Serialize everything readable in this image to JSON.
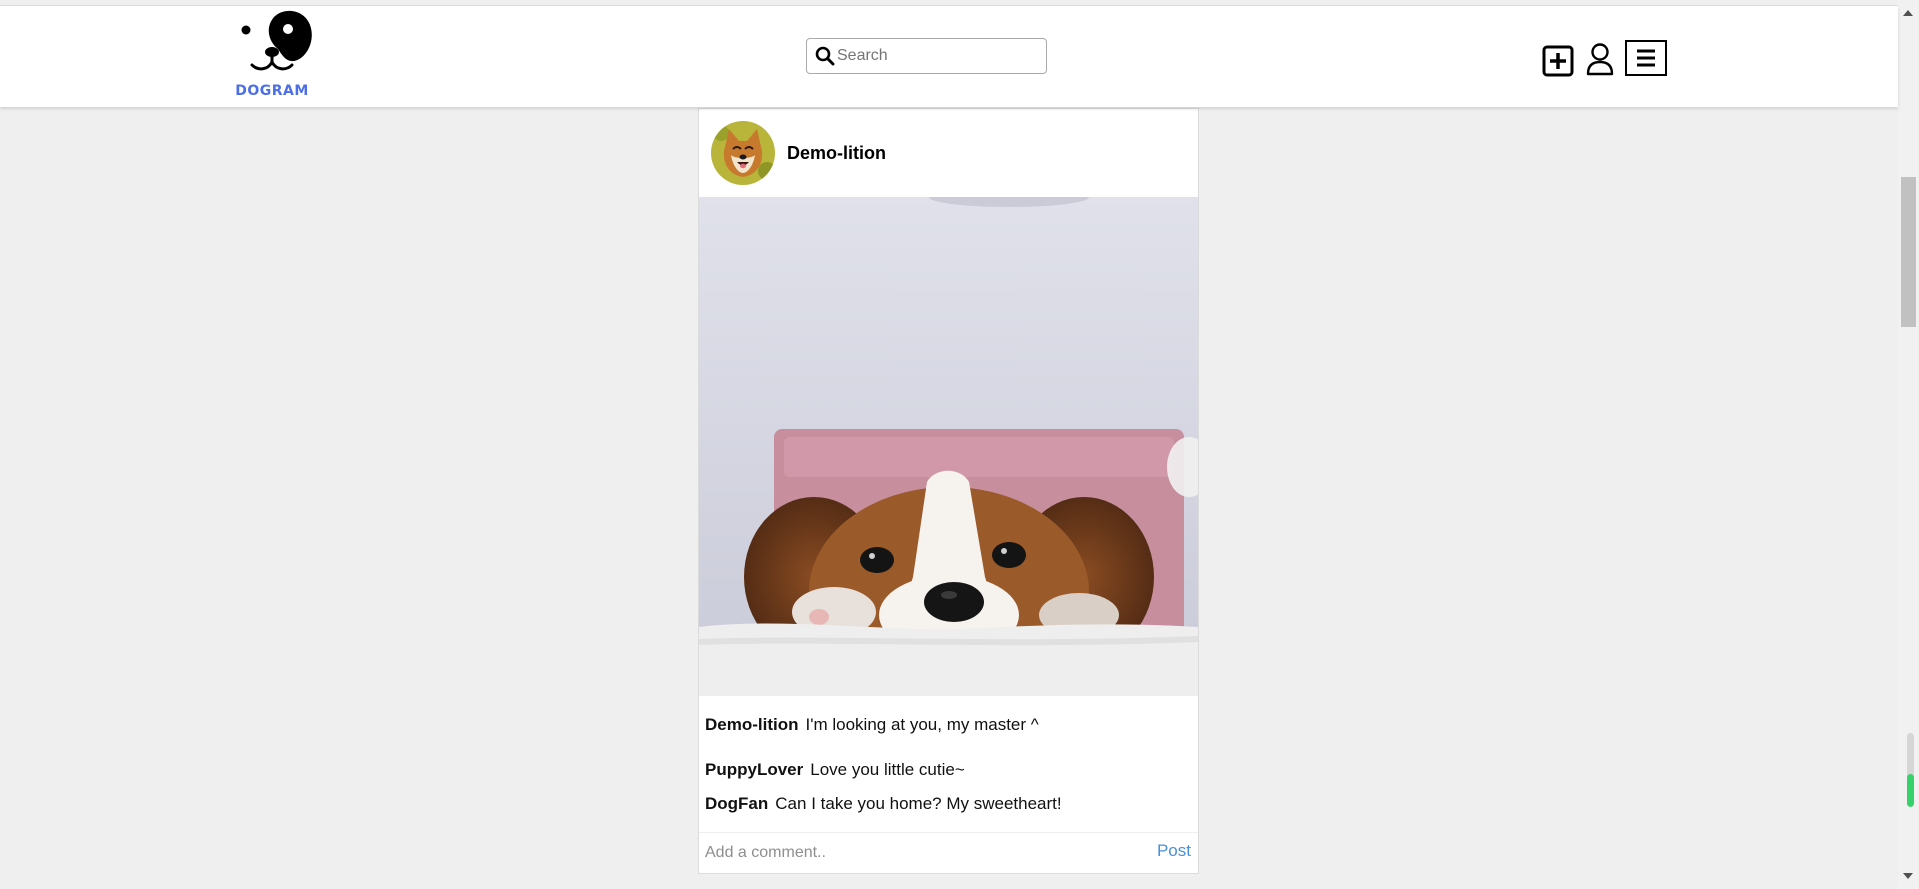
{
  "header": {
    "logo_text": "DOGRAM",
    "search": {
      "placeholder": "Search",
      "value": ""
    },
    "icons": [
      "add-post-icon",
      "user-profile-icon",
      "menu-icon"
    ]
  },
  "post": {
    "username": "Demo-lition",
    "caption": {
      "user": "Demo-lition",
      "text": "I'm looking at you, my master ^"
    },
    "comments": [
      {
        "user": "PuppyLover",
        "text": "Love you little cutie~"
      },
      {
        "user": "DogFan",
        "text": "Can I take you home? My sweetheart!"
      }
    ],
    "comment_input": {
      "placeholder": "Add a comment..",
      "value": ""
    },
    "post_button_label": "Post"
  },
  "colors": {
    "brand": "#4d6fe6",
    "post_link": "#4a90d9",
    "background": "#efefef",
    "indicator": "#36d16a"
  }
}
